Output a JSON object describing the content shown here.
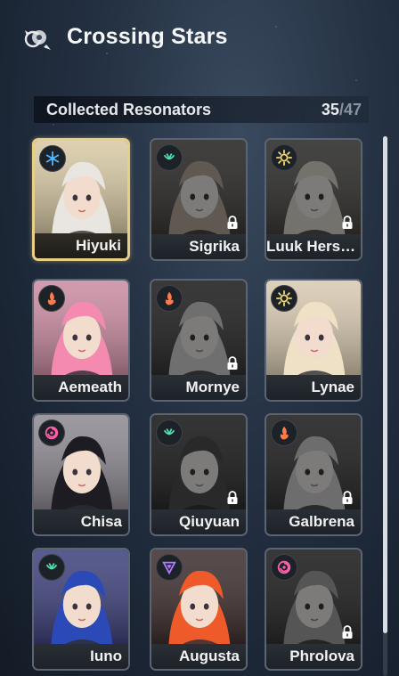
{
  "header": {
    "title": "Crossing Stars",
    "icon": "crossing-stars-emblem-icon"
  },
  "collection": {
    "label": "Collected Resonators",
    "collected": "35",
    "separator": "/",
    "total": "47"
  },
  "cards": [
    {
      "name": "Hiyuki",
      "element": "glacio",
      "element_color": "#4fb6ff",
      "locked": false,
      "selected": true,
      "hair": "#e9e6e1",
      "bg": "#d8c9a4"
    },
    {
      "name": "Sigrika",
      "element": "aero",
      "element_color": "#4fe0b0",
      "locked": true,
      "selected": false,
      "hair": "#f0983a",
      "bg": "#6a5a44"
    },
    {
      "name": "Luuk Hers…",
      "element": "spectro",
      "element_color": "#f3dc74",
      "locked": true,
      "selected": false,
      "hair": "#e8d08a",
      "bg": "#6c6450"
    },
    {
      "name": "Aemeath",
      "element": "fusion",
      "element_color": "#ff7a4a",
      "locked": false,
      "selected": false,
      "hair": "#f58ab0",
      "bg": "#c98aa0"
    },
    {
      "name": "Mornye",
      "element": "fusion",
      "element_color": "#ff7a4a",
      "locked": true,
      "selected": false,
      "hair": "#c9c9cf",
      "bg": "#4d4d55"
    },
    {
      "name": "Lynae",
      "element": "spectro",
      "element_color": "#f3dc74",
      "locked": false,
      "selected": false,
      "hair": "#efe1c6",
      "bg": "#d8c9b0"
    },
    {
      "name": "Chisa",
      "element": "havoc",
      "element_color": "#ff5fa8",
      "locked": false,
      "selected": false,
      "hair": "#1c1c22",
      "bg": "#8c8790"
    },
    {
      "name": "Qiuyuan",
      "element": "aero",
      "element_color": "#4fe0b0",
      "locked": true,
      "selected": false,
      "hair": "#4b4b50",
      "bg": "#3e4145"
    },
    {
      "name": "Galbrena",
      "element": "fusion",
      "element_color": "#ff7a4a",
      "locked": true,
      "selected": false,
      "hair": "#c7c7c7",
      "bg": "#4a4a4e"
    },
    {
      "name": "Iuno",
      "element": "aero",
      "element_color": "#4fe0b0",
      "locked": false,
      "selected": false,
      "hair": "#2b4ab8",
      "bg": "#3b3e7a"
    },
    {
      "name": "Augusta",
      "element": "electro",
      "element_color": "#b27cff",
      "locked": false,
      "selected": false,
      "hair": "#ef5a2a",
      "bg": "#3a2a2a"
    },
    {
      "name": "Phrolova",
      "element": "havoc",
      "element_color": "#ff5fa8",
      "locked": true,
      "selected": false,
      "hair": "#9a9a9a",
      "bg": "#4a4a4a"
    }
  ],
  "scroll_fraction_visible": 0.92
}
